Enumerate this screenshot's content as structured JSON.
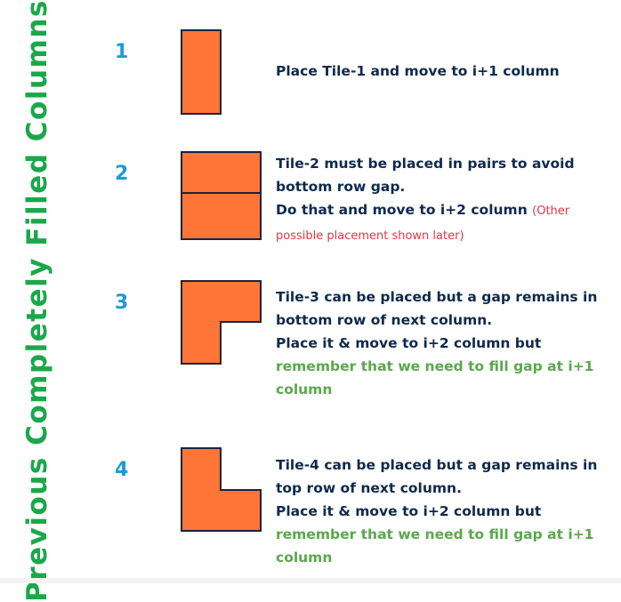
{
  "side_title": "Previous  Completely  Filled  Columns",
  "colors": {
    "tile_fill": "#fd7537",
    "tile_border": "#1c2340",
    "side_title": "#1aa84a",
    "step_number": "#1e9ad6",
    "text": "#0d2a4d",
    "note_red": "#e0383e",
    "remember_green": "#5aa84c"
  },
  "steps": [
    {
      "number": "1",
      "icon": "tile-1-vertical-domino",
      "text": [
        "Place Tile-1 and move to i+1 column"
      ]
    },
    {
      "number": "2",
      "icon": "tile-2-horizontal-pair",
      "text": [
        "Tile-2 must be placed in pairs to avoid",
        "bottom row gap.",
        "Do that and move to i+2 column"
      ],
      "note": "(Other possible placement shown later)"
    },
    {
      "number": "3",
      "icon": "tile-3-l-tromino",
      "text": [
        "Tile-3 can be placed but a gap remains in",
        "bottom row of next column.",
        "Place it & move to i+2 column but"
      ],
      "remember": [
        "remember that we need to fill gap at i+1",
        "column"
      ]
    },
    {
      "number": "4",
      "icon": "tile-4-l-tromino",
      "text": [
        "Tile-4 can be placed but a gap remains in",
        "top row of next column.",
        "Place it & move to i+2 column but"
      ],
      "remember": [
        "remember that we need to fill gap at i+1",
        "column"
      ]
    }
  ]
}
